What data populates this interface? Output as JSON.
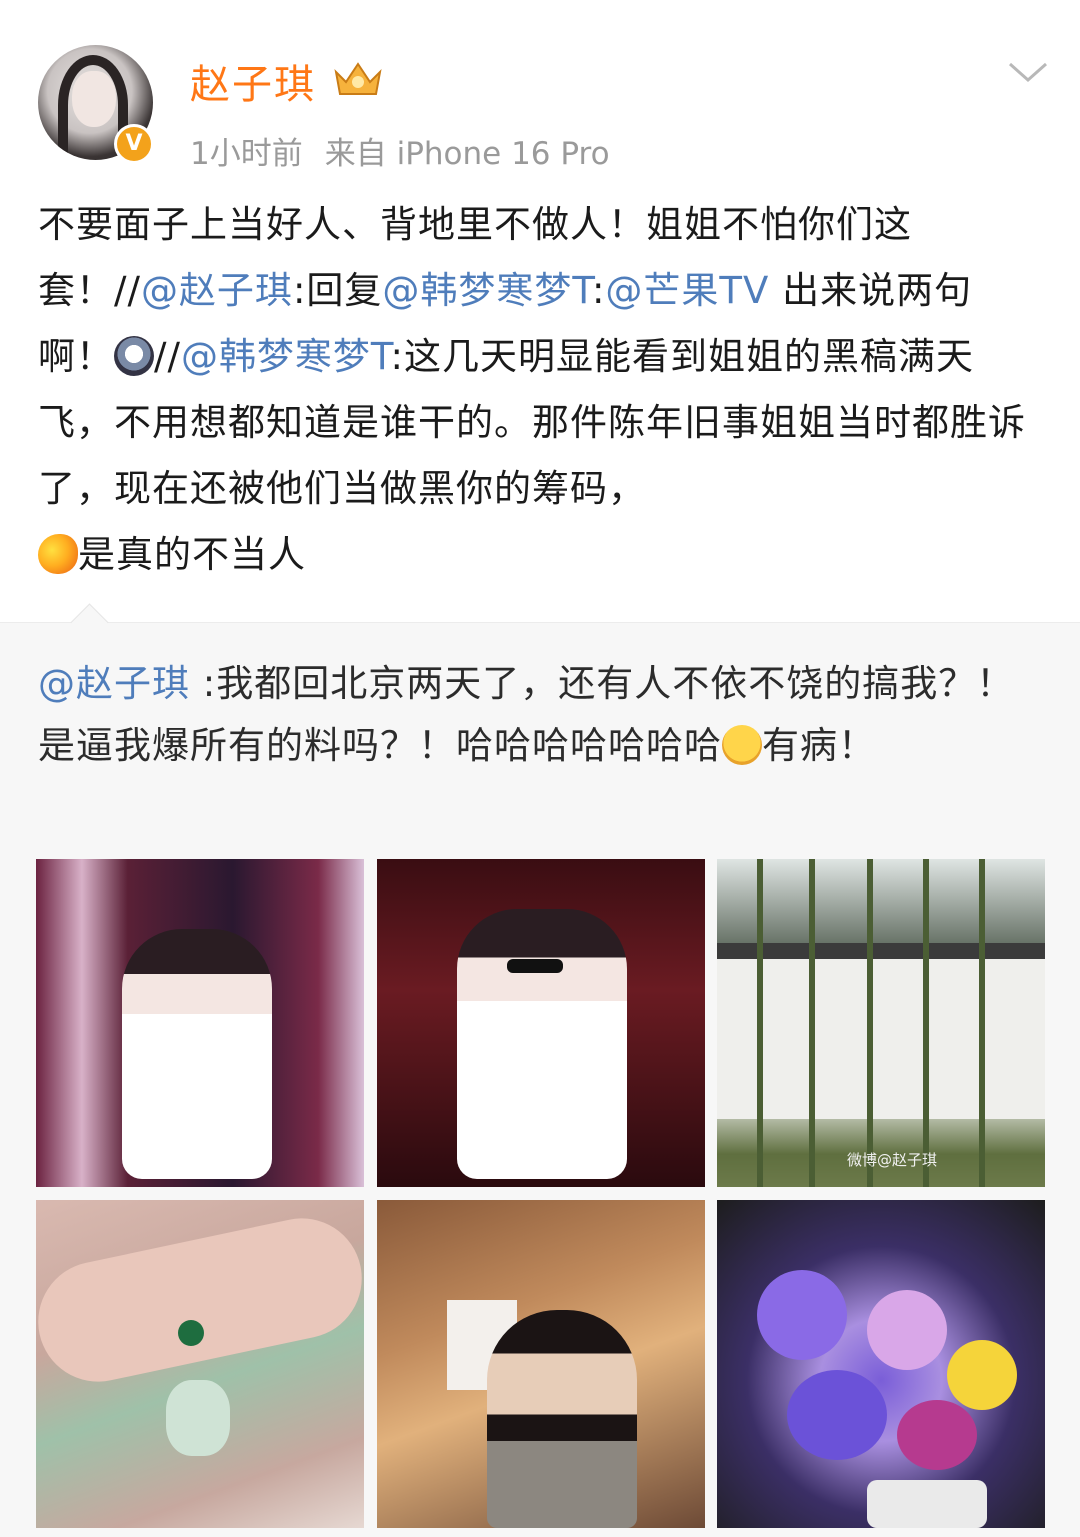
{
  "post": {
    "username": "赵子琪",
    "time": "1小时前",
    "source": "来自 iPhone 16 Pro",
    "verified_badge": "V",
    "body": {
      "seg1": "不要面子上当好人、背地里不做人！姐姐不怕你们这套！//",
      "m1": "@赵子琪",
      "seg2": ":回复",
      "m2": "@韩梦寒梦T",
      "seg3": ":",
      "m3": "@芒果TV",
      "seg4": " 出来说两句啊！",
      "seg5": "//",
      "m4": "@韩梦寒梦T",
      "seg6": ":这几天明显能看到姐姐的黑稿满天飞，不用想都知道是谁干的。那件陈年旧事姐姐当时都胜诉了，现在还被他们当做黑你的筹码，",
      "seg7": "是真的不当人"
    }
  },
  "repost": {
    "mention": "@赵子琪",
    "seg1": " :我都回北京两天了，还有人不依不饶的搞我？！是逼我爆所有的料吗？！哈哈哈哈哈哈哈",
    "seg2": "有病！",
    "watermark": "微博@赵子琪"
  },
  "icons": {
    "crown": "crown-icon",
    "more": "chevron-down-icon",
    "emoji_dog": "doge-emoji",
    "emoji_mango": "mango-emoji",
    "emoji_laugh": "laugh-cry-emoji"
  },
  "colors": {
    "username": "#ff7716",
    "mention": "#4f7dbb",
    "meta": "#9a9a9a",
    "repost_bg": "#f7f7f7"
  }
}
